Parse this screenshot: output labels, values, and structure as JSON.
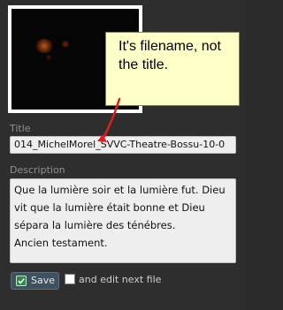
{
  "thumbnail": {
    "alt": "Photo thumbnail"
  },
  "annotation": {
    "text": "It's filename, not the title."
  },
  "fields": {
    "title_label": "Title",
    "title_value": "014_MichelMorel_SVVC-Theatre-Bossu-10-0",
    "description_label": "Description",
    "description_value": "Que la lumière soir et la lumière fut. Dieu vit que la lumière était bonne et Dieu sépara la lumière des ténébres.\nAncien testament."
  },
  "actions": {
    "save_label": "Save",
    "edit_next_label": "and edit next file",
    "edit_next_checked": false
  },
  "colors": {
    "background": "#2e2e2e",
    "callout_fill": "#ffffc8",
    "arrow": "#e21d1d",
    "save_button": "#3f505e"
  },
  "icons": {
    "save": "floppy-check-icon"
  }
}
